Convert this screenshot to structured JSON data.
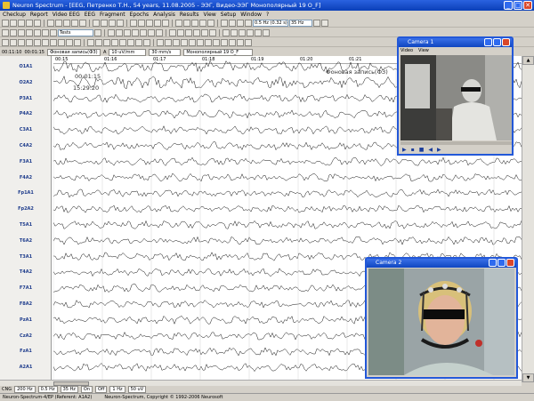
{
  "window": {
    "title": "Neuron Spectrum - [EEG, Петренко Т.Н., 54 years, 11.08.2005 - ЭЭГ, Видео-ЭЭГ Монополярный 19 О_F]",
    "min": "_",
    "max": "□",
    "close": "✕"
  },
  "menu": [
    "Checkup",
    "Report",
    "Video EEG",
    "EEG",
    "Fragment",
    "Epochs",
    "Analysis",
    "Results",
    "View",
    "Setup",
    "Window",
    "?"
  ],
  "toolbar": {
    "tests_label": "Tests",
    "freq_low": "0.5 Hz (0.32 s)",
    "freq_high": "35 Hz"
  },
  "controls": {
    "time_start": "00:11:10",
    "time_end": "00:01:15",
    "record_type": "Фоновая запись(ФЗ)",
    "marker": "A",
    "sensitivity": "10 uV/mm",
    "speed": "30 mm/s",
    "montage": "Монополярный 19 О_F"
  },
  "timescale": [
    "00:15",
    "01:16",
    "01:17",
    "01:18",
    "01:19",
    "01:20",
    "01:21",
    "01:22",
    "01:23"
  ],
  "overlay": {
    "time1": "00:01:15",
    "time2": "15:29:20",
    "record_label": "Фоновая запись(ФЗ)"
  },
  "channels": [
    "O1A1",
    "O2A2",
    "P3A1",
    "P4A2",
    "C3A1",
    "C4A2",
    "F3A1",
    "F4A2",
    "Fp1A1",
    "Fp2A2",
    "T5A1",
    "T6A2",
    "T3A1",
    "T4A2",
    "F7A1",
    "F8A2",
    "PzA1",
    "CzA2",
    "FzA1",
    "A2A1"
  ],
  "camera1": {
    "title": "Camera 1",
    "menu": [
      "Video",
      "View"
    ]
  },
  "camera2": {
    "title": "Camera 2"
  },
  "filterbar": {
    "mode": "CNG",
    "sample_rate": "200 Hz",
    "low_cut": "0.5 Hz",
    "high_cut": "35 Hz",
    "notch": "On",
    "off_label": "Off",
    "time_const": "1 Hz",
    "cal": "50 uV"
  },
  "status": {
    "left": "Neuron-Spectrum-4/EP (Referent: A1A2)",
    "right": "Neuron-Spectrum, Copyright © 1992-2006 Neurosoft"
  },
  "colors": {
    "channel_label": "#1e3c8c",
    "trace": "#111111",
    "titlebar": "#0a3fb8"
  }
}
